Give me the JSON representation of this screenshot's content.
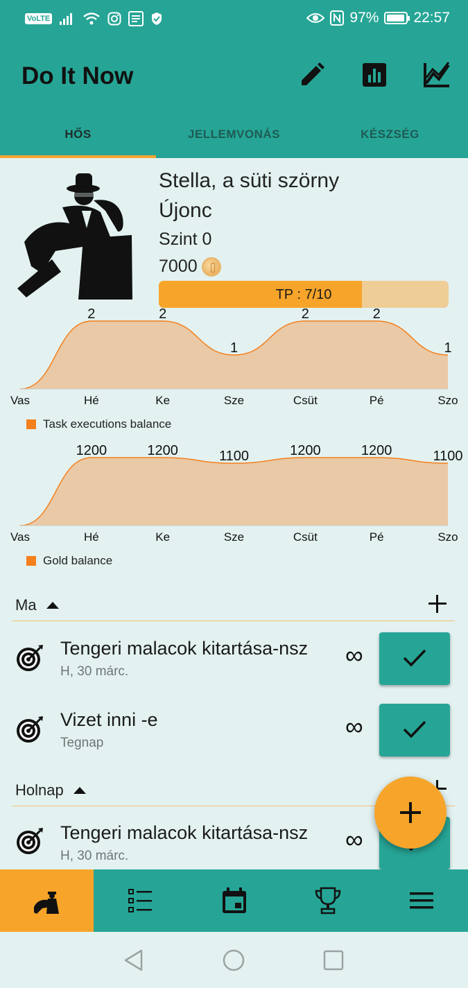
{
  "status_bar": {
    "volte": "VoLTE",
    "battery": "97%",
    "time": "22:57"
  },
  "app": {
    "title": "Do It Now"
  },
  "tabs": [
    {
      "label": "HŐS",
      "active": true
    },
    {
      "label": "JELLEMVONÁS",
      "active": false
    },
    {
      "label": "KÉSZSÉG",
      "active": false
    }
  ],
  "hero": {
    "name": "Stella, a süti szörny",
    "rank": "Újonc",
    "level": "Szint 0",
    "gold": "7000",
    "tp_text": "TP : 7/10",
    "tp_fraction": 0.7
  },
  "chart_data": [
    {
      "type": "area",
      "categories": [
        "Vas",
        "Hé",
        "Ke",
        "Sze",
        "Csüt",
        "Pé",
        "Szo"
      ],
      "series": [
        {
          "name": "Task executions balance",
          "values": [
            0,
            2,
            2,
            1,
            2,
            2,
            1
          ]
        }
      ],
      "data_labels": [
        "",
        "2",
        "2",
        "1",
        "2",
        "2",
        "1"
      ],
      "ylim": [
        0,
        2
      ],
      "legend": "bottom-left",
      "color": "#f47f1c",
      "fill": "#e9c9a6"
    },
    {
      "type": "area",
      "categories": [
        "Vas",
        "Hé",
        "Ke",
        "Sze",
        "Csüt",
        "Pé",
        "Szo"
      ],
      "series": [
        {
          "name": "Gold balance",
          "values": [
            0,
            1200,
            1200,
            1100,
            1200,
            1200,
            1100
          ]
        }
      ],
      "data_labels": [
        "",
        "1200",
        "1200",
        "1100",
        "1200",
        "1200",
        "1100"
      ],
      "ylim": [
        0,
        1200
      ],
      "legend": "bottom-left",
      "color": "#f47f1c",
      "fill": "#e9c9a6"
    }
  ],
  "sections": [
    {
      "title": "Ma",
      "tasks": [
        {
          "title": "Tengeri malacok kitartása-nsz",
          "subtitle": "H, 30 márc.",
          "repeat": "∞"
        },
        {
          "title": "Vizet inni -e",
          "subtitle": "Tegnap",
          "repeat": "∞"
        }
      ]
    },
    {
      "title": "Holnap",
      "tasks": [
        {
          "title": "Tengeri malacok kitartása-nsz",
          "subtitle": "H, 30 márc.",
          "repeat": "∞"
        }
      ]
    }
  ],
  "icons": {
    "appbar": [
      "edit-icon",
      "bar-chart-icon",
      "line-chart-icon"
    ],
    "bottom_nav": [
      "hero-icon",
      "task-list-icon",
      "calendar-icon",
      "trophy-icon",
      "menu-icon"
    ],
    "system_nav": [
      "back-icon",
      "home-icon",
      "recents-icon"
    ]
  },
  "colors": {
    "primary": "#26a596",
    "accent": "#f6a52a",
    "background": "#e3f2f1"
  }
}
